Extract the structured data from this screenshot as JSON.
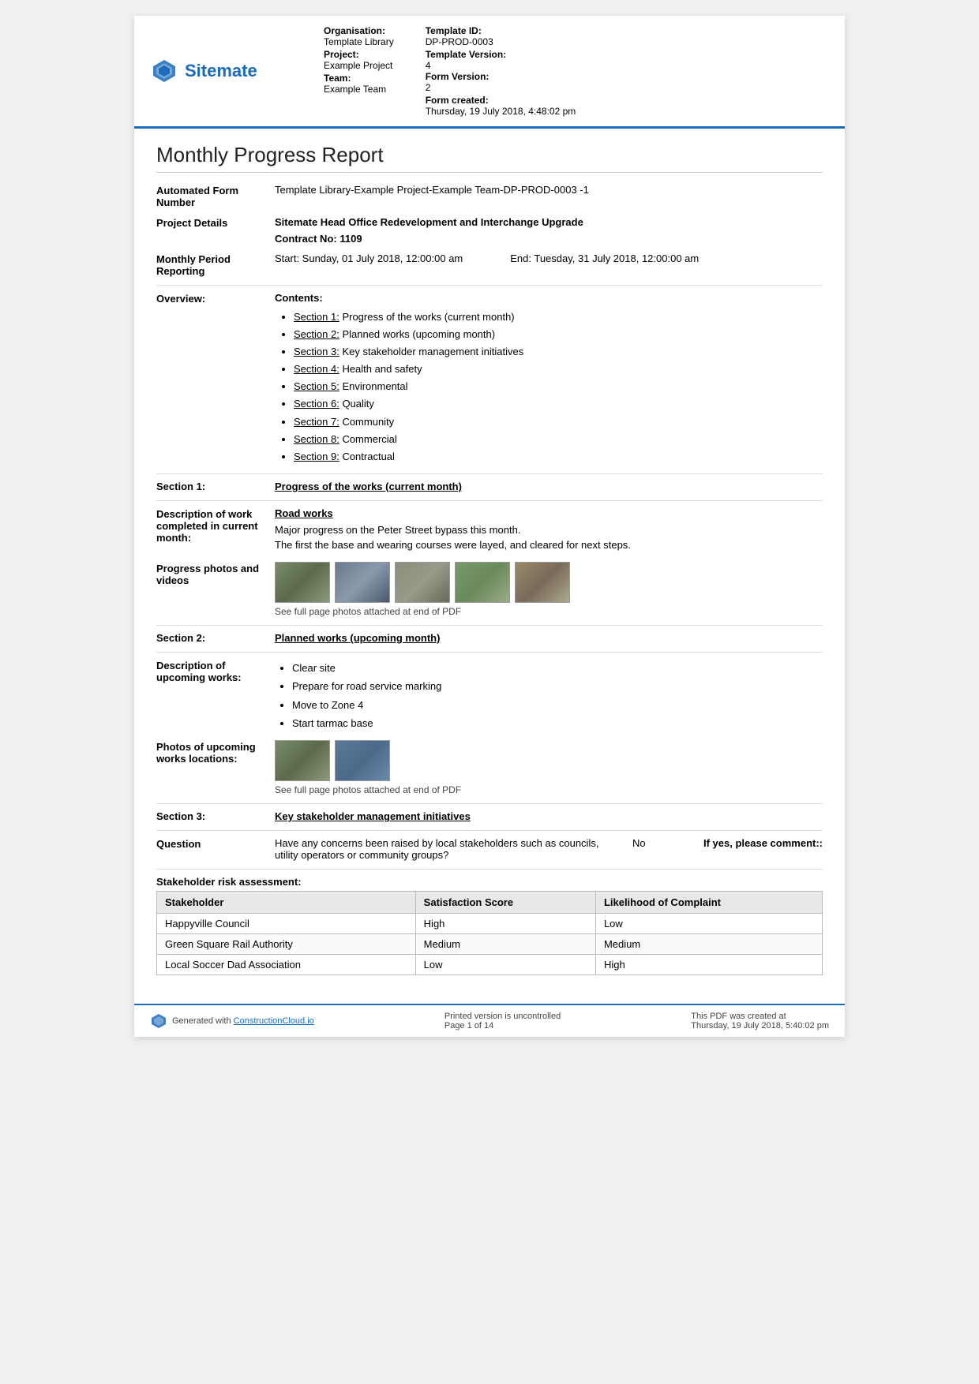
{
  "header": {
    "logo_text": "Sitemate",
    "org_label": "Organisation:",
    "org_value": "Template Library",
    "project_label": "Project:",
    "project_value": "Example Project",
    "team_label": "Team:",
    "team_value": "Example Team",
    "template_id_label": "Template ID:",
    "template_id_value": "DP-PROD-0003",
    "template_version_label": "Template Version:",
    "template_version_value": "4",
    "form_version_label": "Form Version:",
    "form_version_value": "2",
    "form_created_label": "Form created:",
    "form_created_value": "Thursday, 19 July 2018, 4:48:02 pm"
  },
  "report": {
    "title": "Monthly Progress Report",
    "form_number_label": "Automated Form Number",
    "form_number_value": "Template Library-Example Project-Example Team-DP-PROD-0003   -1",
    "project_details_label": "Project Details",
    "project_details_value": "Sitemate Head Office Redevelopment and Interchange Upgrade",
    "contract_label": "Contract No:",
    "contract_value": "1109",
    "period_label": "Monthly Period Reporting",
    "period_start": "Start: Sunday, 01 July 2018, 12:00:00 am",
    "period_end": "End: Tuesday, 31 July 2018, 12:00:00 am",
    "overview_label": "Overview:",
    "contents_label": "Contents:",
    "contents_items": [
      {
        "link": "Section 1:",
        "text": " Progress of the works (current month)"
      },
      {
        "link": "Section 2:",
        "text": " Planned works (upcoming month)"
      },
      {
        "link": "Section 3:",
        "text": " Key stakeholder management initiatives"
      },
      {
        "link": "Section 4:",
        "text": " Health and safety"
      },
      {
        "link": "Section 5:",
        "text": " Environmental"
      },
      {
        "link": "Section 6:",
        "text": " Quality"
      },
      {
        "link": "Section 7:",
        "text": " Community"
      },
      {
        "link": "Section 8:",
        "text": " Commercial"
      },
      {
        "link": "Section 9:",
        "text": " Contractual"
      }
    ],
    "section1_label": "Section 1:",
    "section1_title": "Progress of the works (current month)",
    "desc_work_label": "Description of work completed in current month:",
    "roadworks_title": "Road works",
    "desc_text1": "Major progress on the Peter Street bypass this month.",
    "desc_text2": "The first the base and wearing courses were layed, and cleared for next steps.",
    "photos_label": "Progress photos and videos",
    "photos_caption": "See full page photos attached at end of PDF",
    "section2_label": "Section 2:",
    "section2_title": "Planned works (upcoming month)",
    "upcoming_label": "Description of upcoming works:",
    "upcoming_items": [
      "Clear site",
      "Prepare for road service marking",
      "Move to Zone 4",
      "Start tarmac base"
    ],
    "upcoming_photos_label": "Photos of upcoming works locations:",
    "upcoming_photos_caption": "See full page photos attached at end of PDF",
    "section3_label": "Section 3:",
    "section3_title": "Key stakeholder management initiatives",
    "question_label": "Question",
    "question_text": "Have any concerns been raised by local stakeholders such as councils, utility operators or community groups?",
    "question_answer": "No",
    "question_comment": "If yes, please comment::",
    "stakeholder_table_label": "Stakeholder risk assessment:",
    "table_headers": [
      "Stakeholder",
      "Satisfaction Score",
      "Likelihood of Complaint"
    ],
    "table_rows": [
      [
        "Happyville Council",
        "High",
        "Low"
      ],
      [
        "Green Square Rail Authority",
        "Medium",
        "Medium"
      ],
      [
        "Local Soccer Dad Association",
        "Low",
        "High"
      ]
    ]
  },
  "footer": {
    "generated_text": "Generated with ",
    "generated_link": "ConstructionCloud.io",
    "print_text": "Printed version is uncontrolled",
    "page_text": "Page 1 of 14",
    "created_text": "This PDF was created at",
    "created_date": "Thursday, 19 July 2018, 5:40:02 pm"
  }
}
